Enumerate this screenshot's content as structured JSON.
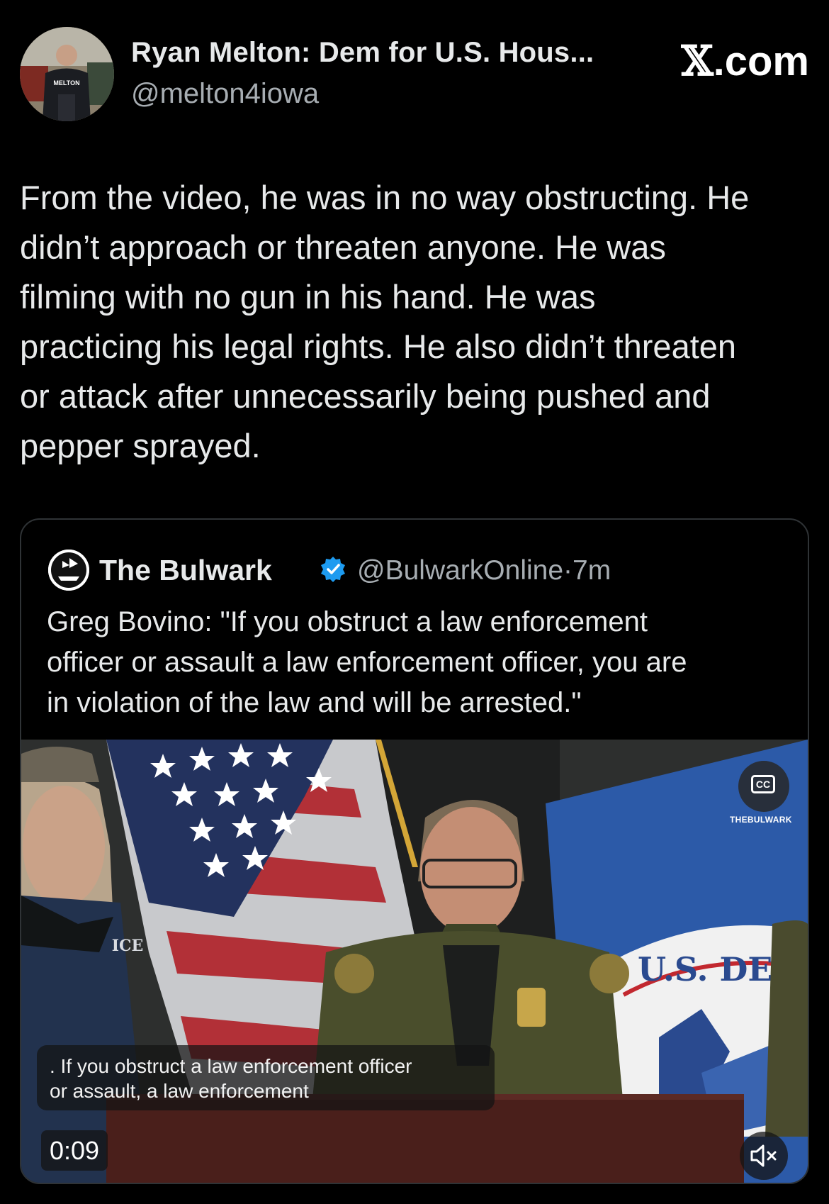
{
  "author": {
    "name": "Ryan Melton: Dem for U.S. Hous...",
    "handle": "@melton4iowa",
    "avatar_shirt_text": "MELTON"
  },
  "brand": {
    "x_glyph": "𝕏",
    "suffix": ".com"
  },
  "tweet": {
    "lines": [
      "From the video, he was in no way obstructing. He",
      "didn’t approach or threaten anyone. He was",
      "filming with no gun in his hand. He was",
      "practicing his legal rights. He also didn’t threaten",
      "or attack after unnecessarily being pushed and",
      "pepper sprayed."
    ]
  },
  "quote": {
    "name": "The Bulwark",
    "verified_icon": "verified-badge-icon",
    "handle": "@BulwarkOnline",
    "separator": "·",
    "age": "7m",
    "lines": [
      "Greg Bovino: \"If you obstruct a law enforcement",
      "officer or assault a law enforcement officer, you are",
      "in violation of the law and will be arrested.\""
    ],
    "video": {
      "caption_lines": [
        ". If you obstruct a law enforcement officer",
        "or assault, a law enforcement"
      ],
      "time": "0:09",
      "cc_label": "CC",
      "watermark": "THEBULWARK",
      "jacket_text": "ICE",
      "seal_text": "U.S. DEP",
      "mute_icon": "speaker-muted-icon"
    }
  },
  "colors": {
    "background": "#000000",
    "text": "#e7e9ea",
    "secondary": "#a7adb2",
    "verified": "#1d9bf0",
    "border": "#2f3336"
  }
}
